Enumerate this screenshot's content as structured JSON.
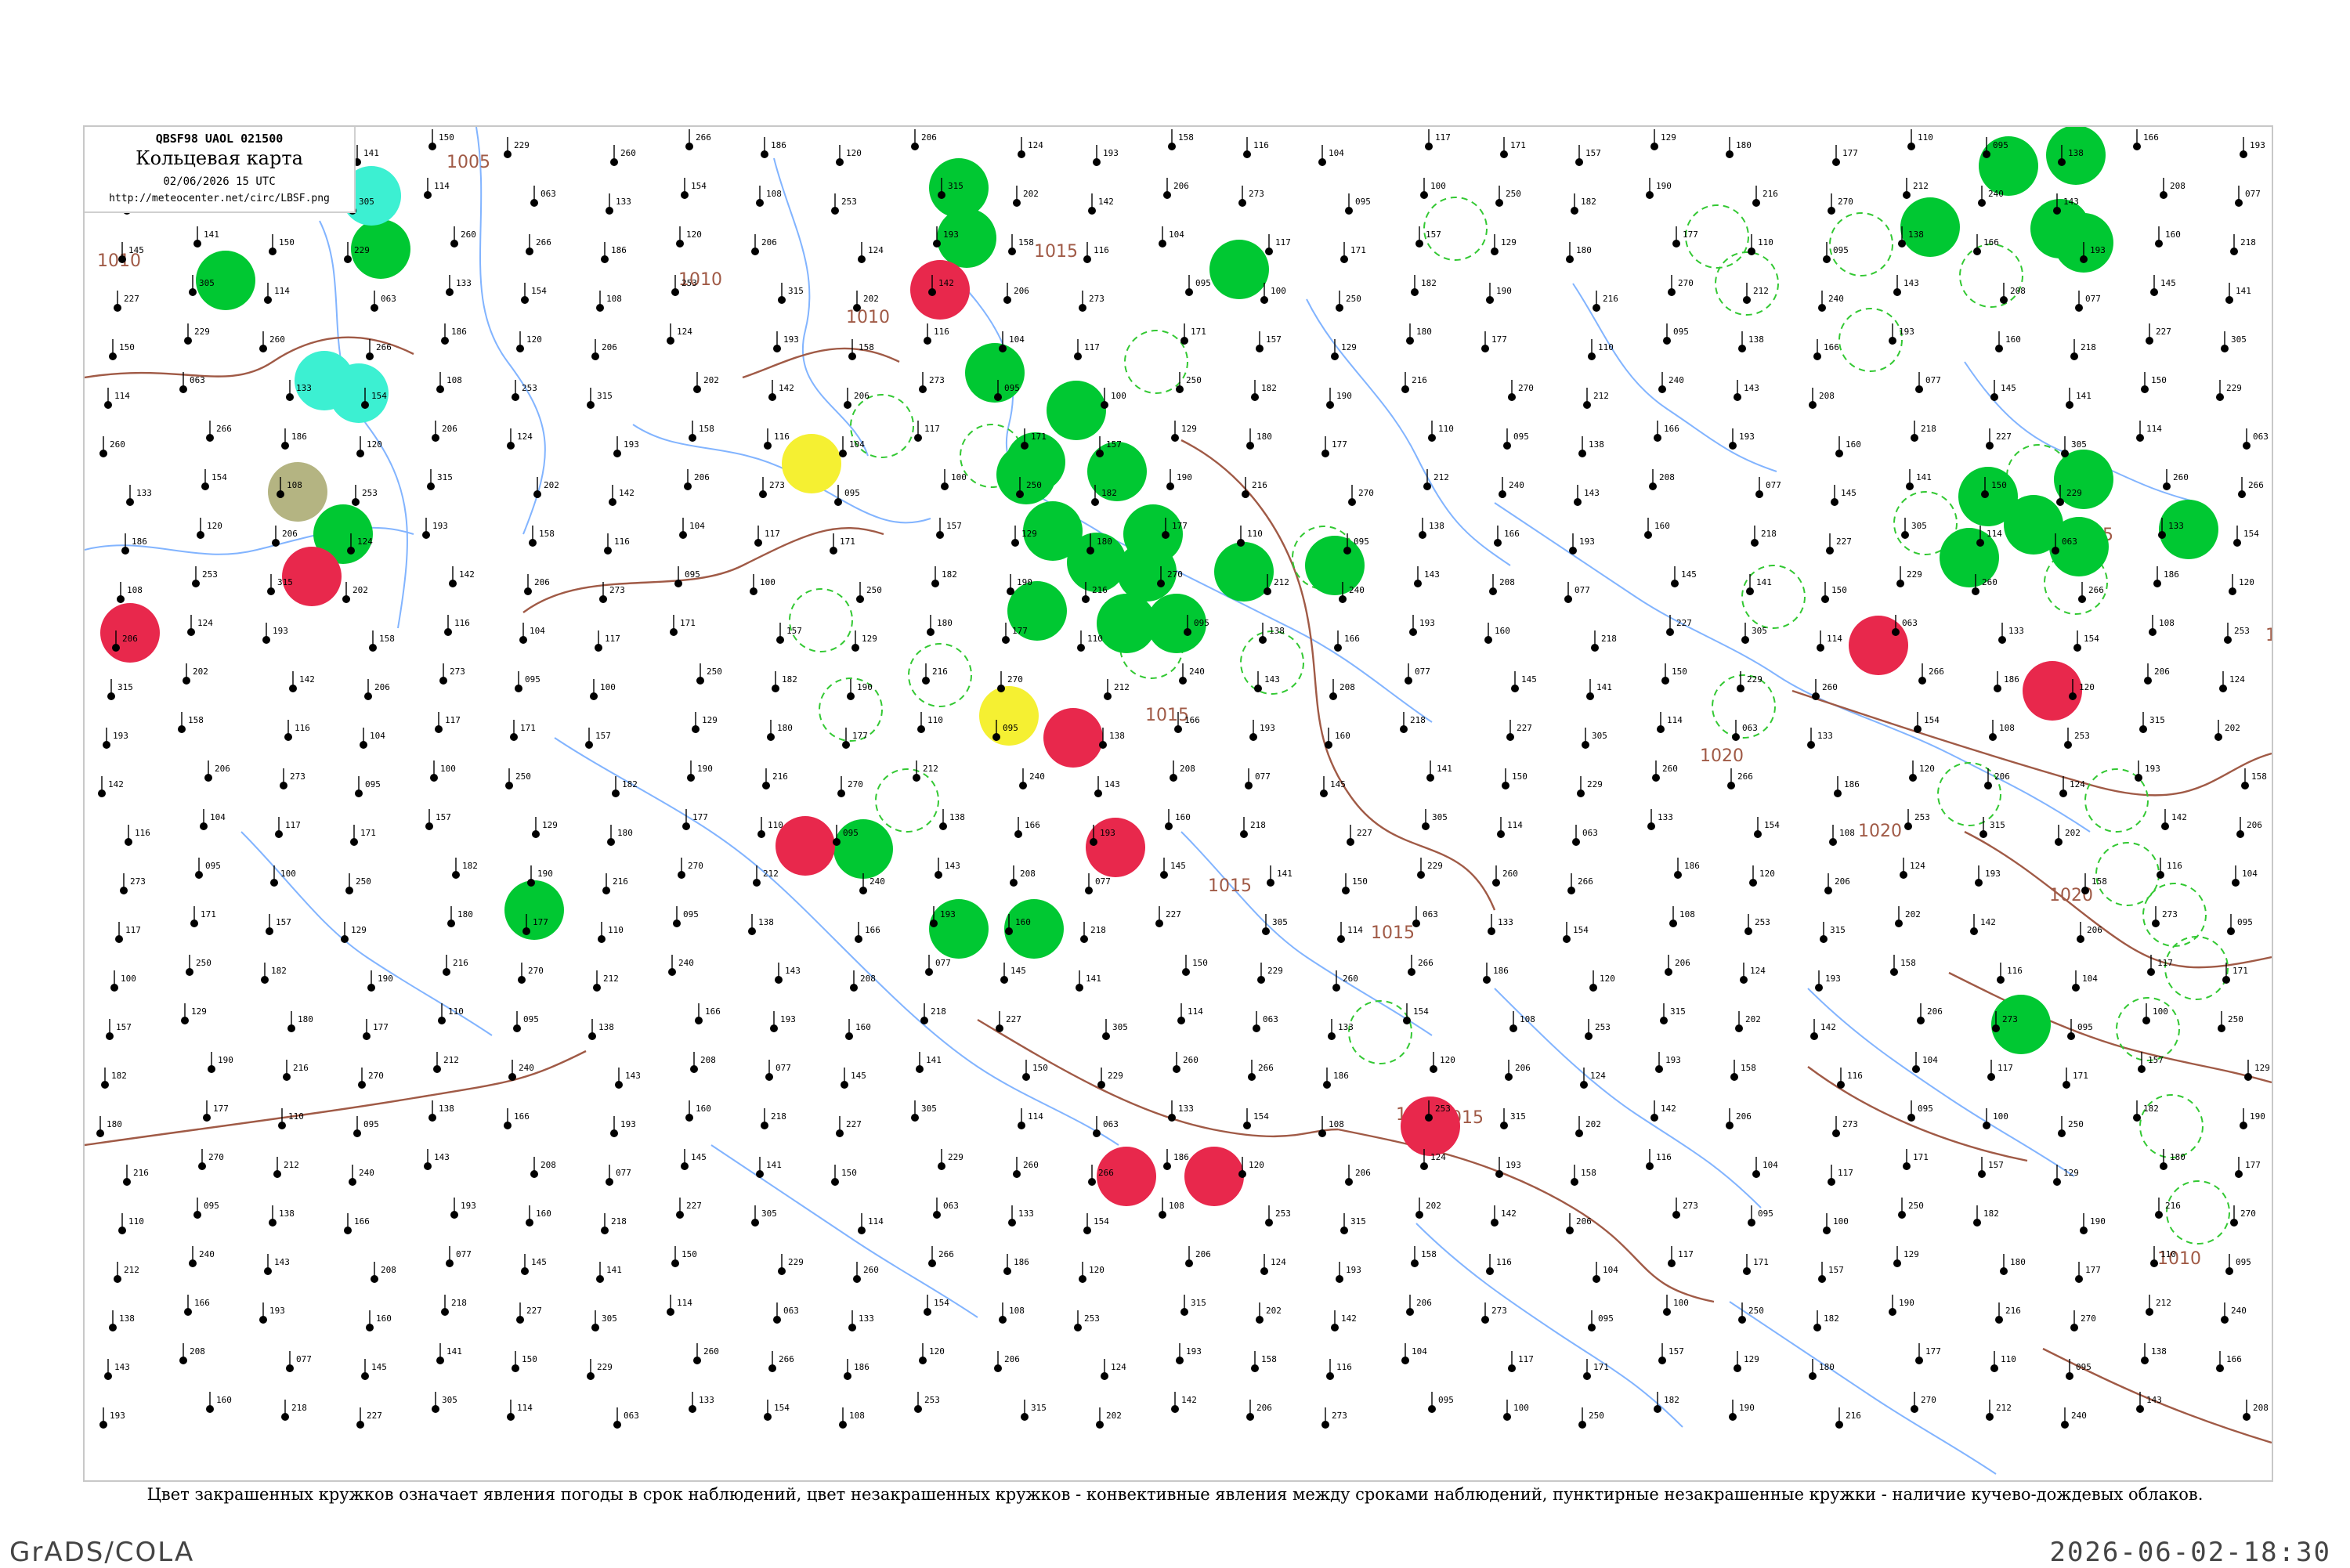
{
  "header": {
    "code_line": "QBSF98  UAOL  021500",
    "title": "Кольцевая карта",
    "date_line": "02/06/2026 15 UTC",
    "url": "http://meteocenter.net/circ/LBSF.png"
  },
  "caption": "Цвет закрашенных кружков означает явления погоды в срок наблюдений, цвет незакрашенных кружков - конвективные явления между сроками наблюдений, пунктирные незакрашенные кружки - наличие кучево-дождевых облаков.",
  "footer": {
    "software": "GrADS/COLA",
    "timestamp": "2026-06-02-18:30"
  },
  "colors": {
    "filled_green": "#00c832",
    "filled_red": "#e8284c",
    "filled_yellow": "#f5f032",
    "filled_cyan": "#3cf0d2",
    "filled_olive": "#b4b482",
    "dashed_green": "#32c832",
    "open_red": "#e8284c",
    "isobar": "#a05a46",
    "river": "#82b4ff",
    "station": "#000000"
  },
  "isobar_labels": [
    "1010",
    "1010",
    "1010",
    "1005",
    "1015",
    "1015",
    "1015",
    "1015",
    "1015",
    "1015",
    "1015",
    "1020",
    "1020",
    "1020",
    "1020",
    "1010"
  ],
  "station_values": [
    "208",
    "077",
    "145",
    "141",
    "150",
    "229",
    "260",
    "266",
    "186",
    "120",
    "206",
    "124",
    "193",
    "158",
    "116",
    "104",
    "117",
    "171",
    "157",
    "129",
    "180",
    "177",
    "110",
    "095",
    "138",
    "166",
    "193",
    "160",
    "218",
    "227",
    "305",
    "114",
    "063",
    "133",
    "154",
    "108",
    "253",
    "315",
    "202",
    "142",
    "206",
    "273",
    "095",
    "100",
    "250",
    "182",
    "190",
    "216",
    "270",
    "212",
    "240",
    "143"
  ]
}
